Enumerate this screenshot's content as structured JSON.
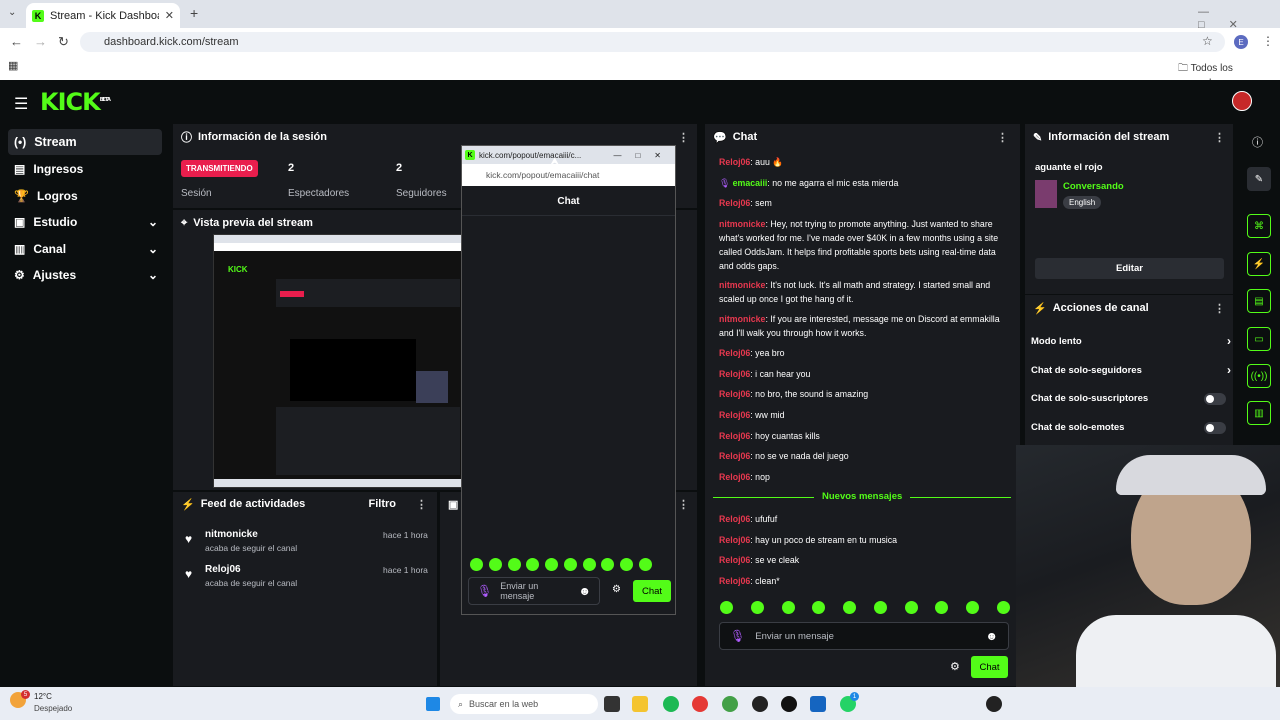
{
  "browser": {
    "tab_title": "Stream - Kick Dashboard",
    "url": "dashboard.kick.com/stream",
    "bookmarks_label": "Todos los marcadores",
    "avatar": "E"
  },
  "app": {
    "logo": "KICK",
    "logo_sup": "BETA"
  },
  "nav": [
    {
      "label": "Stream",
      "icon": "broadcast-icon",
      "active": true
    },
    {
      "label": "Ingresos",
      "icon": "ledger-icon"
    },
    {
      "label": "Logros",
      "icon": "trophy-icon"
    },
    {
      "label": "Estudio",
      "icon": "video-icon",
      "chevron": true
    },
    {
      "label": "Canal",
      "icon": "channel-icon",
      "chevron": true
    },
    {
      "label": "Ajustes",
      "icon": "gear-icon",
      "chevron": true
    }
  ],
  "session": {
    "title": "Información de la sesión",
    "badge": "TRANSMITIENDO",
    "session_label": "Sesión",
    "viewers_num": "2",
    "viewers_label": "Espectadores",
    "followers_num": "2",
    "followers_label": "Seguidores"
  },
  "preview": {
    "title": "Vista previa del stream"
  },
  "activity": {
    "title": "Feed de actividades",
    "filter": "Filtro",
    "items": [
      {
        "user": "nitmonicke",
        "text": "acaba de seguir el canal",
        "time": "hace 1 hora"
      },
      {
        "user": "Reloj06",
        "text": "acaba de seguir el canal",
        "time": "hace 1 hora"
      }
    ]
  },
  "popout": {
    "title": "kick.com/popout/emacaiii/c...",
    "url": "kick.com/popout/emacaiii/chat",
    "header": "Chat",
    "input_placeholder": "Enviar un mensaje",
    "send": "Chat"
  },
  "chat": {
    "title": "Chat",
    "new_messages": "Nuevos mensajes",
    "input_placeholder": "Enviar un mensaje",
    "send": "Chat",
    "messages": [
      {
        "user": "Reloj06",
        "text": ": auu 🔥",
        "color": "#e8384f"
      },
      {
        "user": "emacaiii",
        "text": ": no me agarra el mic esta mierda",
        "color": "#53fc18"
      },
      {
        "user": "Reloj06",
        "text": ": sem",
        "color": "#e8384f"
      },
      {
        "user": "nitmonicke",
        "text": ": Hey, not trying to promote anything. Just wanted to share what's worked for me. I've made over $40K in a few months using a site called OddsJam. It helps find profitable sports bets using real-time data and odds gaps.",
        "color": "#e8384f"
      },
      {
        "user": "nitmonicke",
        "text": ": It's not luck. It's all math and strategy. I started small and scaled up once I got the hang of it.",
        "color": "#e8384f"
      },
      {
        "user": "nitmonicke",
        "text": ": If you are interested, message me on Discord at emmakilla and I'll walk you through how it works.",
        "color": "#e8384f"
      },
      {
        "user": "Reloj06",
        "text": ": yea bro",
        "color": "#e8384f"
      },
      {
        "user": "Reloj06",
        "text": ": i can hear you",
        "color": "#e8384f"
      },
      {
        "user": "Reloj06",
        "text": ": no bro, the sound is amazing",
        "color": "#e8384f"
      },
      {
        "user": "Reloj06",
        "text": ": ww mid",
        "color": "#e8384f"
      },
      {
        "user": "Reloj06",
        "text": ": hoy cuantas kills",
        "color": "#e8384f"
      },
      {
        "user": "Reloj06",
        "text": ": no se ve nada del juego",
        "color": "#e8384f"
      },
      {
        "user": "Reloj06",
        "text": ": nop",
        "color": "#e8384f"
      }
    ],
    "new": [
      {
        "user": "Reloj06",
        "text": ": ufufuf"
      },
      {
        "user": "Reloj06",
        "text": ": hay un poco de stream en tu musica"
      },
      {
        "user": "Reloj06",
        "text": ": se ve cleak"
      },
      {
        "user": "Reloj06",
        "text": ": clean*"
      }
    ]
  },
  "stream_info": {
    "title": "Información del stream",
    "stream_title": "aguante el rojo",
    "category": "Conversando",
    "language": "English",
    "edit": "Editar"
  },
  "actions": {
    "title": "Acciones de canal",
    "items": [
      "Modo lento",
      "Chat de solo-seguidores",
      "Chat de solo-suscriptores",
      "Chat de solo-emotes"
    ]
  },
  "taskbar": {
    "temp": "12°C",
    "weather": "Despejado",
    "search": "Buscar en la web",
    "notif": "5",
    "badge": "1"
  },
  "colors": {
    "accent": "#53fc18",
    "live": "#e91e4d",
    "username": "#e8384f"
  }
}
